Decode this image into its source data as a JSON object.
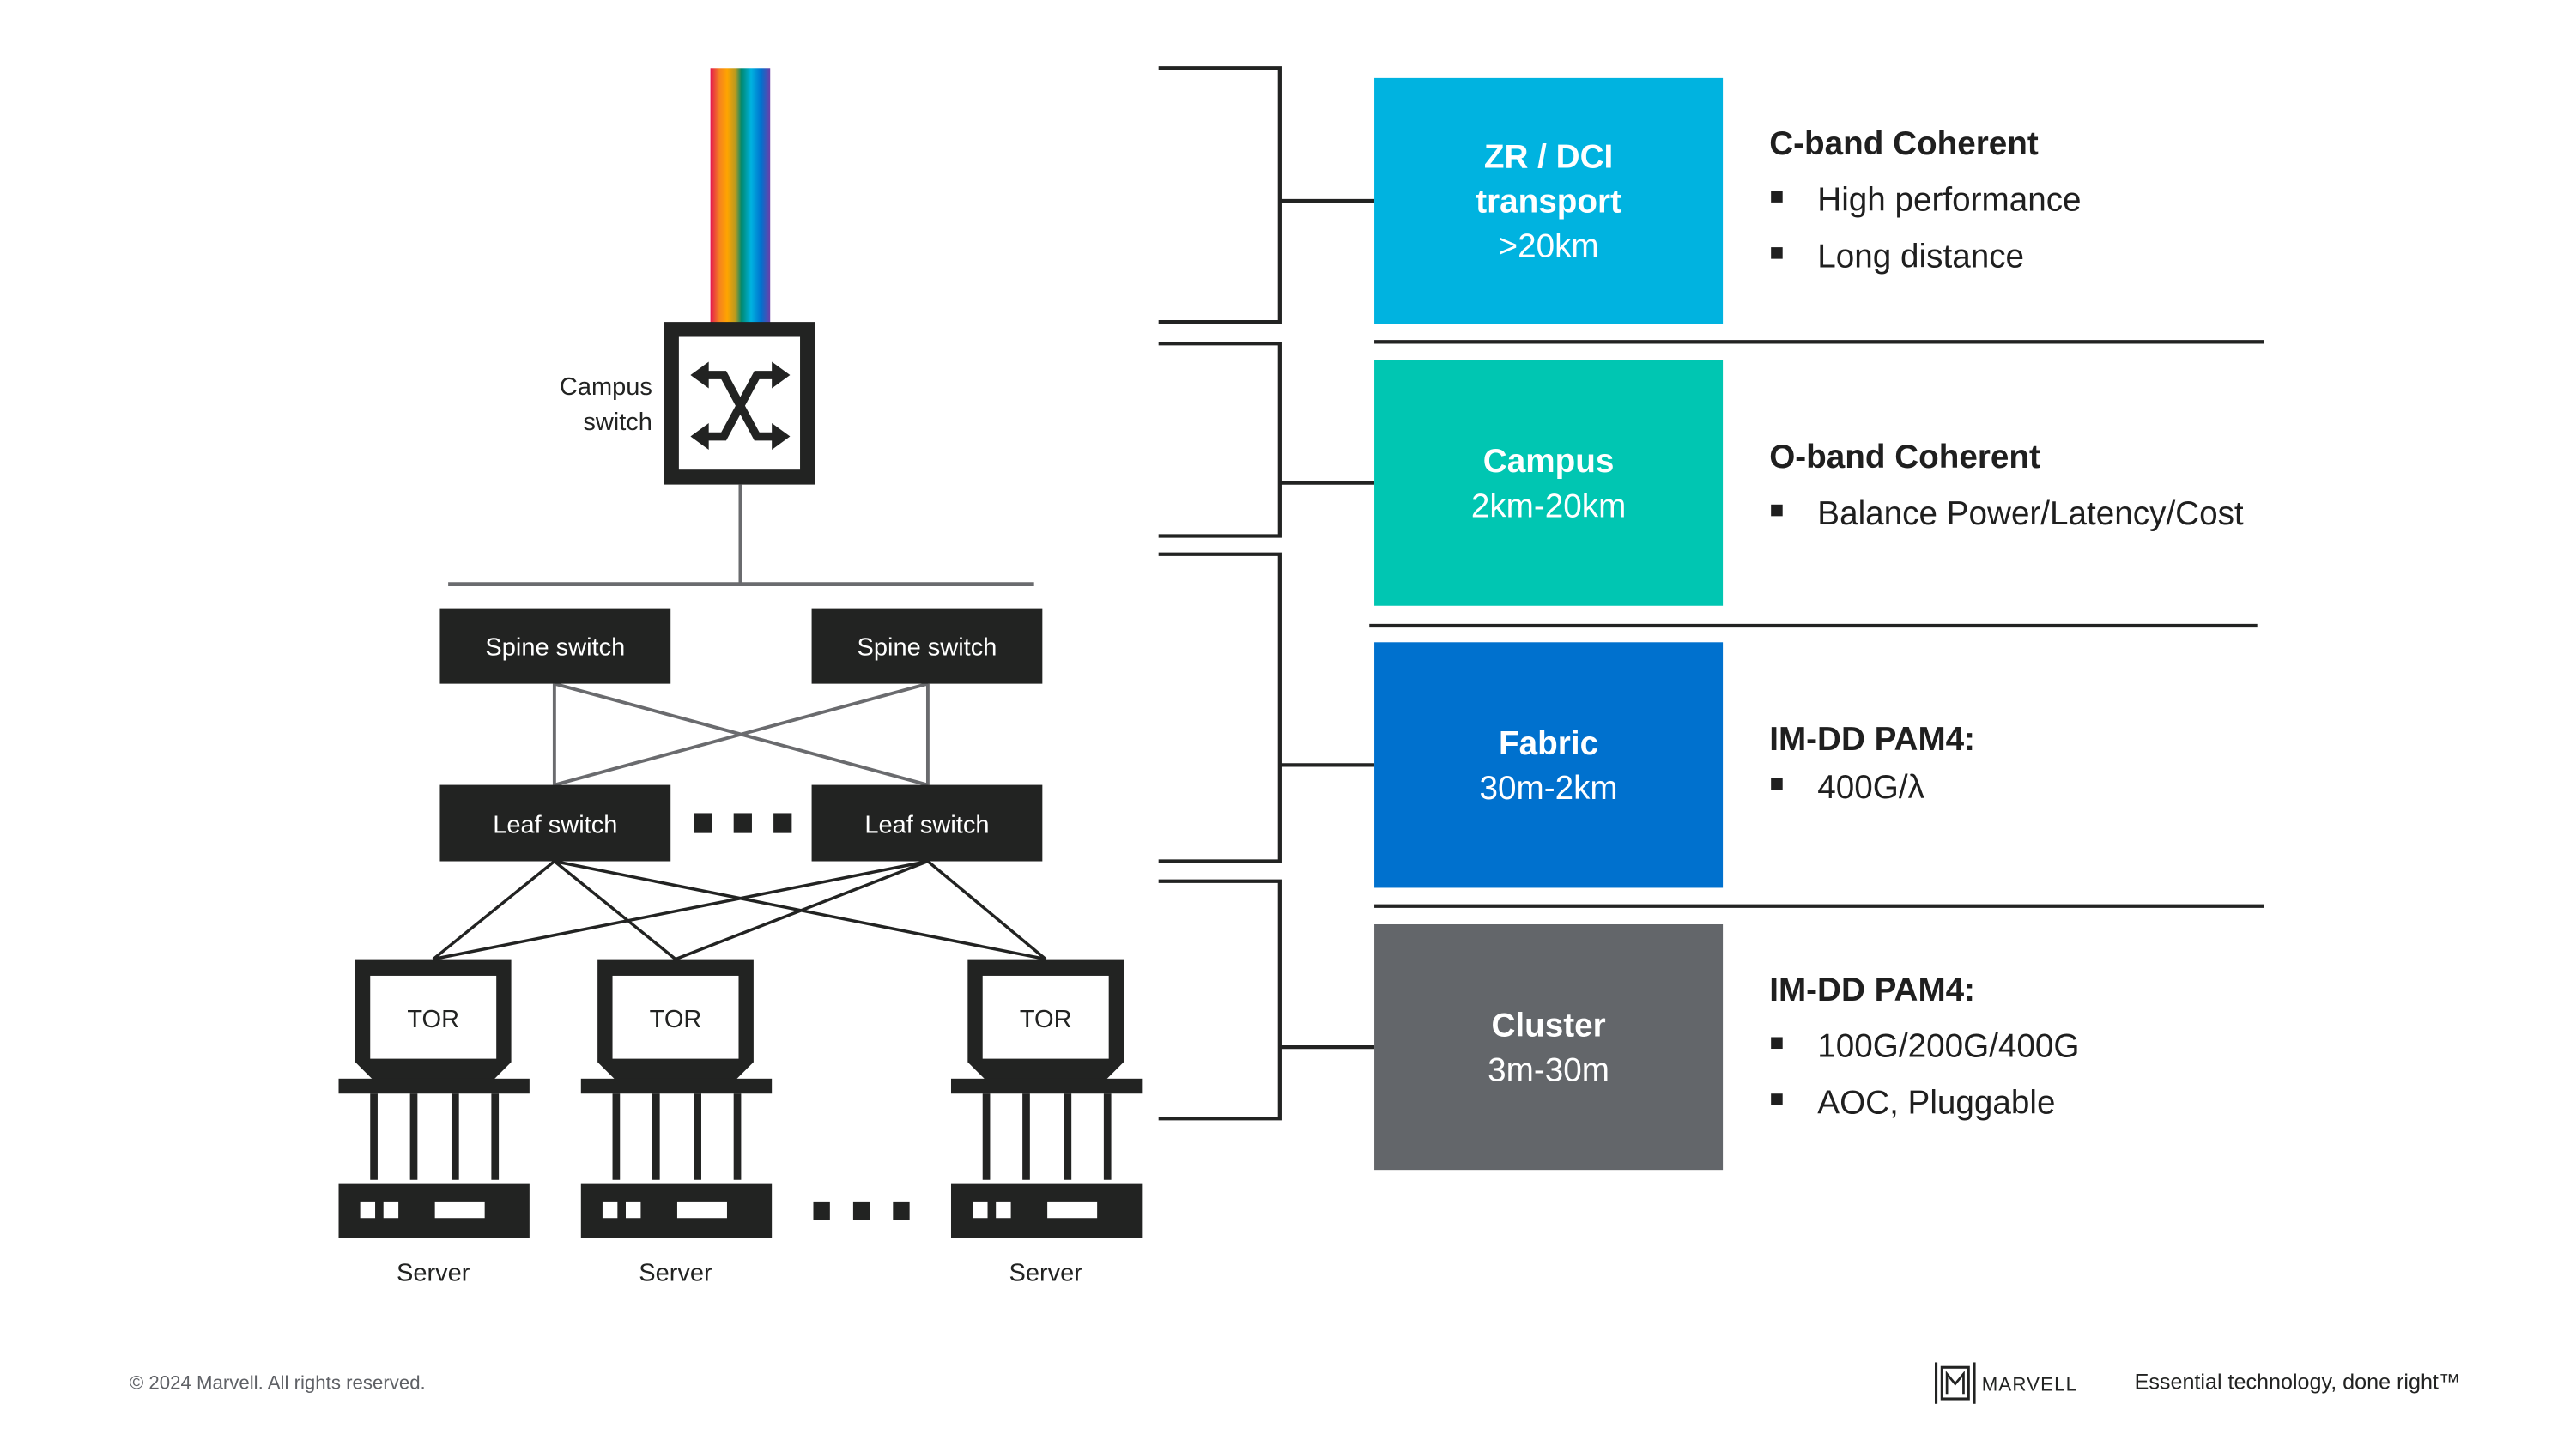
{
  "colors": {
    "zr_dci": "#00B3E0",
    "campus": "#00C6B2",
    "fabric": "#0071CE",
    "cluster": "#63666A",
    "dark": "#222322",
    "link_gray": "#6A6B6E"
  },
  "diagram": {
    "campus_switch": {
      "label_line1": "Campus",
      "label_line2": "switch",
      "icon": "crossover-arrows-icon"
    },
    "spine_switches": [
      {
        "label": "Spine switch"
      },
      {
        "label": "Spine switch"
      }
    ],
    "leaf_switches": [
      {
        "label": "Leaf switch"
      },
      {
        "label": "Leaf switch"
      }
    ],
    "racks": [
      {
        "tor_label": "TOR",
        "server_label": "Server"
      },
      {
        "tor_label": "TOR",
        "server_label": "Server"
      },
      {
        "tor_label": "TOR",
        "server_label": "Server"
      }
    ],
    "fiber_icon": "rainbow-fiber-icon"
  },
  "tiers": [
    {
      "title_lines": [
        "ZR / DCI",
        "transport"
      ],
      "range": ">20km",
      "color_key": "zr_dci",
      "heading": "C-band Coherent",
      "bullets": [
        "High performance",
        "Long distance"
      ]
    },
    {
      "title_lines": [
        "Campus"
      ],
      "range": "2km-20km",
      "color_key": "campus",
      "heading": "O-band Coherent",
      "bullets": [
        "Balance Power/Latency/Cost"
      ]
    },
    {
      "title_lines": [
        "Fabric"
      ],
      "range": "30m-2km",
      "color_key": "fabric",
      "heading": "IM-DD PAM4:",
      "bullets": [
        "400G/λ"
      ]
    },
    {
      "title_lines": [
        "Cluster"
      ],
      "range": "3m-30m",
      "color_key": "cluster",
      "heading": "IM-DD PAM4:",
      "bullets": [
        "100G/200G/400G",
        "AOC, Pluggable"
      ]
    }
  ],
  "footer": {
    "copyright": "© 2024 Marvell. All rights reserved.",
    "logo_text": "MARVELL",
    "tagline": "Essential technology, done right™"
  }
}
